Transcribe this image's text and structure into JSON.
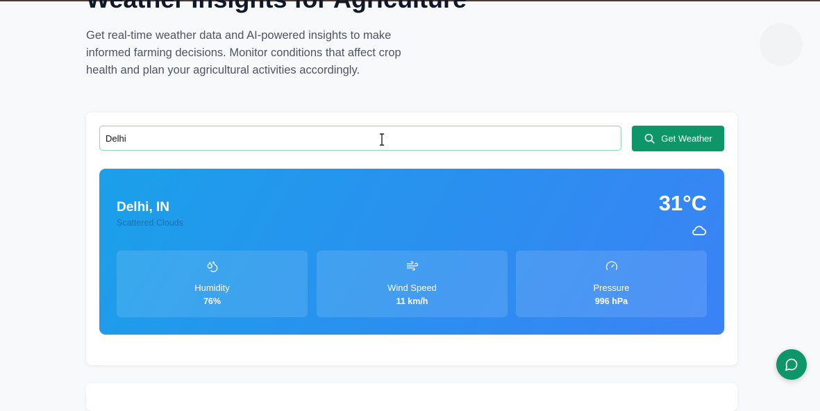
{
  "page": {
    "title": "Weather Insights for Agriculture",
    "intro": "Get real-time weather data and AI-powered insights to make informed farming decisions. Monitor conditions that affect crop health and plan your agricultural activities accordingly."
  },
  "search": {
    "value": "Delhi",
    "button_label": "Get Weather"
  },
  "weather": {
    "location": "Delhi, IN",
    "description": "Scattered Clouds",
    "temperature": "31°C",
    "condition_icon": "cloud-icon",
    "stats": [
      {
        "icon": "droplets-icon",
        "label": "Humidity",
        "value": "76%"
      },
      {
        "icon": "wind-icon",
        "label": "Wind Speed",
        "value": "11 km/h"
      },
      {
        "icon": "gauge-icon",
        "label": "Pressure",
        "value": "996 hPa"
      }
    ]
  },
  "chat": {
    "icon": "chat-bubble-icon"
  },
  "colors": {
    "accent_green": "#0e9668",
    "card_blue_start": "#1ba0ea",
    "card_blue_end": "#3b82f6"
  }
}
